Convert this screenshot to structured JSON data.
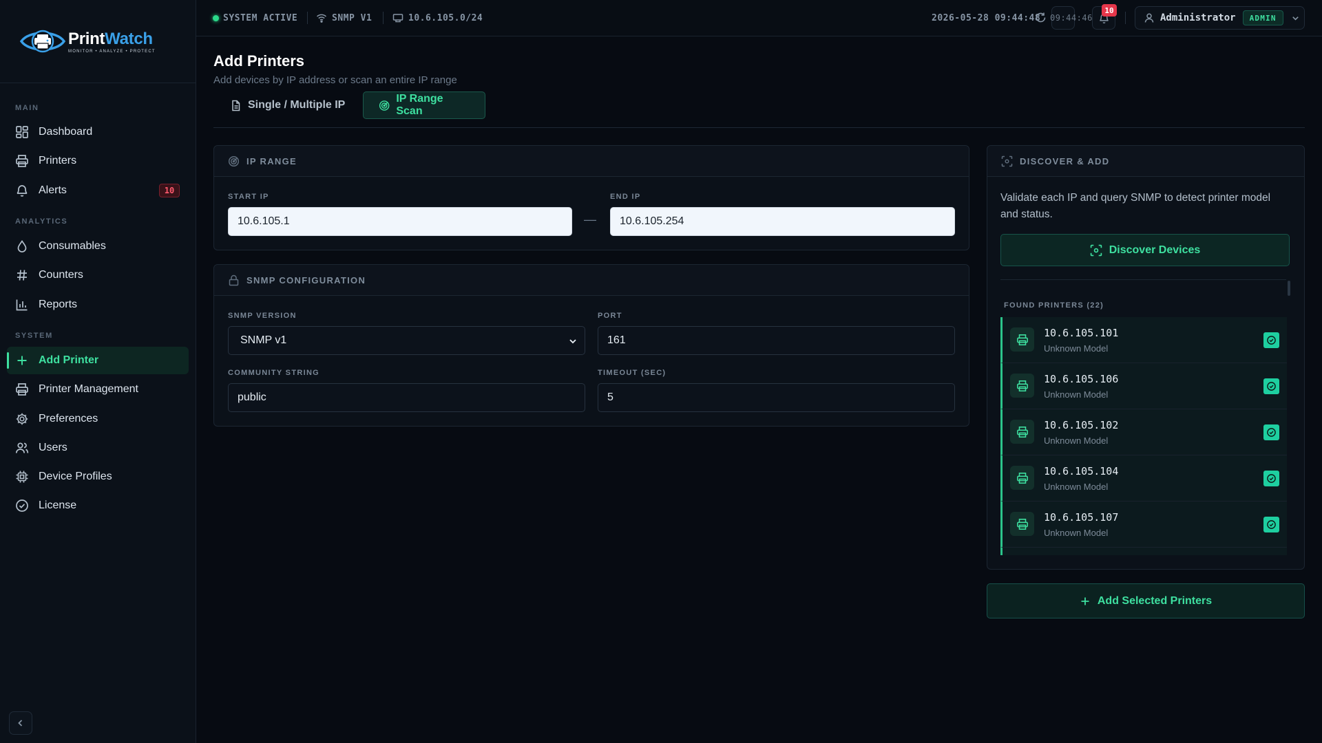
{
  "brand": {
    "name_part1": "Print",
    "name_part2": "Watch",
    "tagline": "MONITOR • ANALYZE • PROTECT"
  },
  "topbar": {
    "status": "SYSTEM ACTIVE",
    "snmp": "SNMP V1",
    "network": "10.6.105.0/24",
    "datetime": "2026-05-28 09:44:48",
    "refresh_time": "09:44:46",
    "notification_count": "10",
    "user_name": "Administrator",
    "user_role": "ADMIN"
  },
  "sidebar": {
    "sections": {
      "main": "MAIN",
      "analytics": "ANALYTICS",
      "system": "SYSTEM"
    },
    "items": [
      {
        "label": "Dashboard",
        "icon": "dashboard-icon"
      },
      {
        "label": "Printers",
        "icon": "printer-icon"
      },
      {
        "label": "Alerts",
        "icon": "bell-icon",
        "badge": "10"
      },
      {
        "label": "Consumables",
        "icon": "droplet-icon"
      },
      {
        "label": "Counters",
        "icon": "hash-icon"
      },
      {
        "label": "Reports",
        "icon": "bar-chart-icon"
      },
      {
        "label": "Add Printer",
        "icon": "plus-icon",
        "active": true
      },
      {
        "label": "Printer Management",
        "icon": "printer-icon"
      },
      {
        "label": "Preferences",
        "icon": "gear-icon"
      },
      {
        "label": "Users",
        "icon": "users-icon"
      },
      {
        "label": "Device Profiles",
        "icon": "chip-icon"
      },
      {
        "label": "License",
        "icon": "check-circle-icon"
      }
    ]
  },
  "page": {
    "title": "Add Printers",
    "subtitle": "Add devices by IP address or scan an entire IP range",
    "tabs": [
      {
        "label": "Single / Multiple IP",
        "active": false
      },
      {
        "label": "IP Range Scan",
        "active": true
      }
    ]
  },
  "ip_range": {
    "header": "IP RANGE",
    "start_label": "START IP",
    "start_value": "10.6.105.1",
    "end_label": "END IP",
    "end_value": "10.6.105.254",
    "separator": "—"
  },
  "snmp_config": {
    "header": "SNMP CONFIGURATION",
    "version_label": "SNMP VERSION",
    "version_value": "SNMP v1",
    "port_label": "PORT",
    "port_value": "161",
    "community_label": "COMMUNITY STRING",
    "community_value": "public",
    "timeout_label": "TIMEOUT (SEC)",
    "timeout_value": "5"
  },
  "discover": {
    "header": "DISCOVER & ADD",
    "description": "Validate each IP and query SNMP to detect printer model and status.",
    "button_label": "Discover Devices",
    "found_title": "FOUND PRINTERS (22)",
    "printers": [
      {
        "ip": "10.6.105.101",
        "model": "Unknown Model",
        "selected": true
      },
      {
        "ip": "10.6.105.106",
        "model": "Unknown Model",
        "selected": true
      },
      {
        "ip": "10.6.105.102",
        "model": "Unknown Model",
        "selected": true
      },
      {
        "ip": "10.6.105.104",
        "model": "Unknown Model",
        "selected": true
      },
      {
        "ip": "10.6.105.107",
        "model": "Unknown Model",
        "selected": true
      }
    ]
  },
  "actions": {
    "add_selected": "Add Selected Printers"
  },
  "colors": {
    "accent": "#3ee0a0",
    "brand_blue": "#3aa0e8",
    "alert_red": "#ff5a6e",
    "background": "#070b12"
  }
}
